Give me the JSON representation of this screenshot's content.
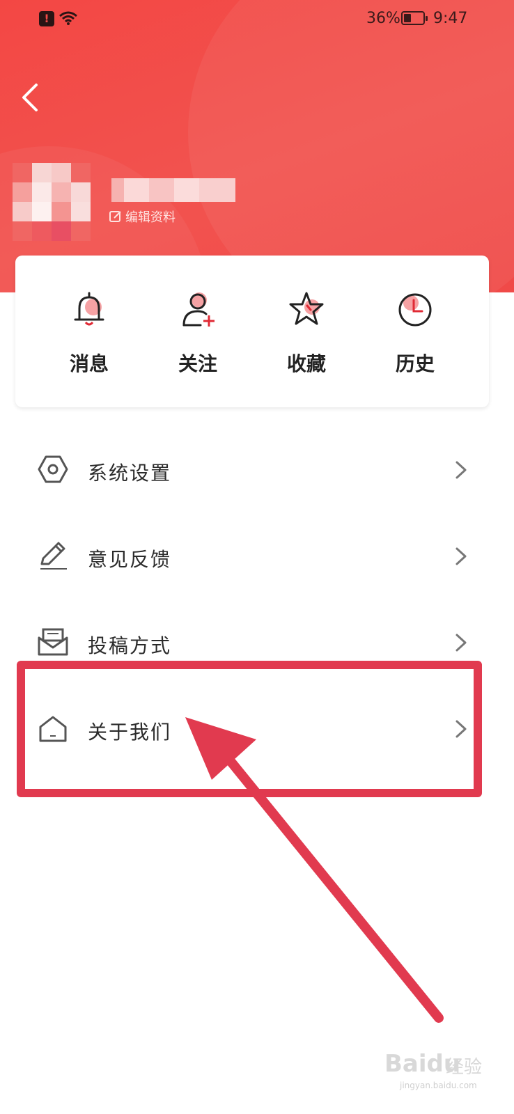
{
  "status_bar": {
    "battery": "36%",
    "time": "9:47"
  },
  "profile": {
    "edit_label": "编辑资料"
  },
  "quick_actions": [
    {
      "label": "消息",
      "icon": "bell-icon"
    },
    {
      "label": "关注",
      "icon": "follow-user-icon"
    },
    {
      "label": "收藏",
      "icon": "star-icon"
    },
    {
      "label": "历史",
      "icon": "clock-icon"
    }
  ],
  "menu": [
    {
      "label": "系统设置",
      "icon": "settings-hexagon-icon"
    },
    {
      "label": "意见反馈",
      "icon": "pencil-icon"
    },
    {
      "label": "投稿方式",
      "icon": "envelope-icon"
    },
    {
      "label": "关于我们",
      "icon": "house-icon"
    }
  ],
  "watermark": {
    "brand": "Baidu",
    "name": "经验",
    "url": "jingyan.baidu.com"
  },
  "colors": {
    "accent": "#f34744",
    "highlight": "#e13a4f"
  }
}
